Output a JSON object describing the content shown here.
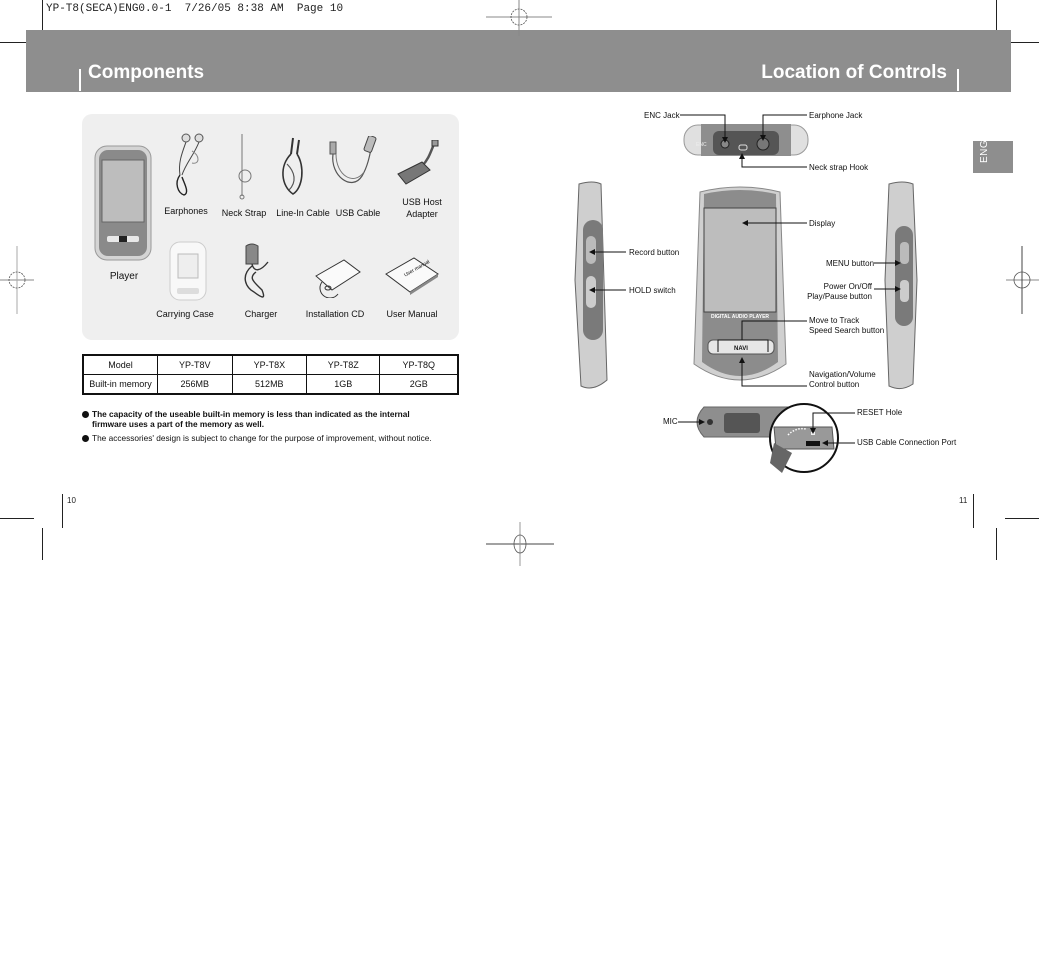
{
  "slug": "YP-T8(SECA)ENG0.0-1  7/26/05 8:38 AM  Page 10",
  "header": {
    "left_title": "Components",
    "right_title": "Location of Controls"
  },
  "components": {
    "items": [
      {
        "label": "Player",
        "icon": "player-device-icon"
      },
      {
        "label": "Earphones",
        "icon": "earphones-icon"
      },
      {
        "label": "Neck Strap",
        "icon": "neck-strap-icon"
      },
      {
        "label": "Line-In Cable",
        "icon": "line-in-cable-icon"
      },
      {
        "label": "USB Cable",
        "icon": "usb-cable-icon"
      },
      {
        "label_line1": "USB Host",
        "label_line2": "Adapter",
        "icon": "usb-host-adapter-icon"
      },
      {
        "label": "Carrying Case",
        "icon": "carrying-case-icon"
      },
      {
        "label": "Charger",
        "icon": "charger-icon"
      },
      {
        "label": "Installation CD",
        "icon": "installation-cd-icon"
      },
      {
        "label": "User Manual",
        "icon": "user-manual-icon"
      }
    ]
  },
  "spec_table": {
    "headers": [
      "Model",
      "YP-T8V",
      "YP-T8X",
      "YP-T8Z",
      "YP-T8Q"
    ],
    "rows": [
      [
        "Built-in memory",
        "256MB",
        "512MB",
        "1GB",
        "2GB"
      ]
    ]
  },
  "notes": [
    {
      "bold": true,
      "line1": "The capacity of the useable built-in memory is less than indicated as the internal",
      "line2": "firmware uses a part of the memory as well."
    },
    {
      "bold": false,
      "line1": "The accessories' design is subject to change for the purpose of improvement, without notice."
    }
  ],
  "controls": {
    "enc_jack": "ENC Jack",
    "earphone_jack": "Earphone Jack",
    "neck_strap_hook": "Neck strap Hook",
    "display": "Display",
    "record_button": "Record button",
    "hold_switch": "HOLD switch",
    "menu_button": "MENU button",
    "power_line1": "Power On/Off",
    "power_line2": "Play/Pause button",
    "move_line1": "Move to Track",
    "move_line2": "Speed Search button",
    "nav_line1": "Navigation/Volume",
    "nav_line2": "Control button",
    "mic": "MIC",
    "reset_hole": "RESET Hole",
    "usb_port": "USB Cable Connection Port",
    "device_text": "DIGITAL AUDIO PLAYER",
    "nav_text": "NAVI",
    "enc_text": "ENC"
  },
  "side_tab": "ENG",
  "page_numbers": {
    "left": "10",
    "right": "11"
  },
  "colors": {
    "banner": "#8e8e8e",
    "panel": "#efefef",
    "text": "#111111"
  }
}
